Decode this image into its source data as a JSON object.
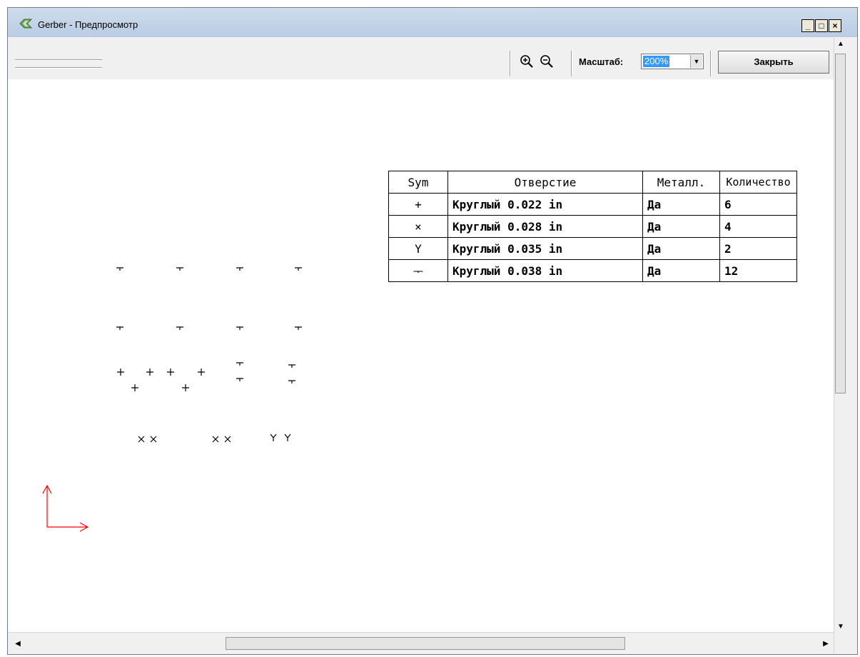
{
  "window": {
    "title": "Gerber - Предпросмотр",
    "controls": [
      "_",
      "□",
      "×"
    ]
  },
  "toolbar": {
    "scale_label": "Масштаб:",
    "scale_value": "200%",
    "close_label": "Закрыть"
  },
  "table": {
    "headers": [
      "Sym",
      "Отверстие",
      "Металл.",
      "Количество"
    ],
    "rows": [
      {
        "sym": "+",
        "hole": "Круглый 0.022 in",
        "plated": "Да",
        "qty": "6"
      },
      {
        "sym": "×",
        "hole": "Круглый 0.028 in",
        "plated": "Да",
        "qty": "4"
      },
      {
        "sym": "Y",
        "hole": "Круглый 0.035 in",
        "plated": "Да",
        "qty": "2"
      },
      {
        "sym": "ᅮ",
        "hole": "Круглый 0.038 in",
        "plated": "Да",
        "qty": "12"
      }
    ]
  },
  "colors": {
    "axis": "#ff0000",
    "symbol": "#000000"
  }
}
